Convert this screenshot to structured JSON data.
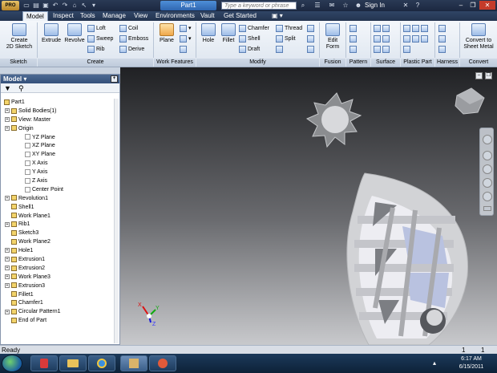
{
  "title_bar": {
    "app_button": "PRO",
    "document_title": "Part1",
    "search_placeholder": "Type a keyword or phrase",
    "sign_in": "Sign In",
    "icons": [
      "new-icon",
      "open-icon",
      "save-icon",
      "undo-icon",
      "redo-icon",
      "home-icon",
      "select-icon",
      "find-icon",
      "star-icon",
      "help-icon",
      "minimize-icon",
      "restore-icon",
      "close-icon"
    ]
  },
  "tabs": [
    "Model",
    "Inspect",
    "Tools",
    "Manage",
    "View",
    "Environments",
    "Vault",
    "Get Started"
  ],
  "active_tab": "Model",
  "ribbon": {
    "sketch": {
      "label": "Sketch",
      "create_2d": "Create\n2D Sketch"
    },
    "create": {
      "label": "Create",
      "extrude": "Extrude",
      "revolve": "Revolve",
      "loft": "Loft",
      "sweep": "Sweep",
      "rib": "Rib",
      "coil": "Coil",
      "emboss": "Emboss",
      "derive": "Derive"
    },
    "work_features": {
      "label": "Work Features",
      "plane": "Plane"
    },
    "modify": {
      "label": "Modify",
      "hole": "Hole",
      "fillet": "Fillet",
      "chamfer": "Chamfer",
      "shell": "Shell",
      "draft": "Draft",
      "thread": "Thread",
      "split": "Split"
    },
    "fusion": {
      "label": "Fusion",
      "edit_form": "Edit\nForm"
    },
    "pattern": {
      "label": "Pattern"
    },
    "surface": {
      "label": "Surface"
    },
    "plastic_part": {
      "label": "Plastic Part"
    },
    "harness": {
      "label": "Harness"
    },
    "convert": {
      "label": "Convert",
      "convert_sheet_metal": "Convert to\nSheet Metal"
    }
  },
  "browser": {
    "title": "Model",
    "items": [
      {
        "label": "Part1",
        "level": 0,
        "expander": false
      },
      {
        "label": "Solid Bodies(1)",
        "level": 1,
        "expander": true
      },
      {
        "label": "View: Master",
        "level": 1,
        "expander": true
      },
      {
        "label": "Origin",
        "level": 1,
        "expander": true
      },
      {
        "label": "YZ Plane",
        "level": 2,
        "expander": false
      },
      {
        "label": "XZ Plane",
        "level": 2,
        "expander": false
      },
      {
        "label": "XY Plane",
        "level": 2,
        "expander": false
      },
      {
        "label": "X Axis",
        "level": 2,
        "expander": false
      },
      {
        "label": "Y Axis",
        "level": 2,
        "expander": false
      },
      {
        "label": "Z Axis",
        "level": 2,
        "expander": false
      },
      {
        "label": "Center Point",
        "level": 2,
        "expander": false
      },
      {
        "label": "Revolution1",
        "level": 1,
        "expander": true
      },
      {
        "label": "Shell1",
        "level": 1,
        "expander": false
      },
      {
        "label": "Work Plane1",
        "level": 1,
        "expander": false
      },
      {
        "label": "Rib1",
        "level": 1,
        "expander": true
      },
      {
        "label": "Sketch3",
        "level": 1,
        "expander": false
      },
      {
        "label": "Work Plane2",
        "level": 1,
        "expander": false
      },
      {
        "label": "Hole1",
        "level": 1,
        "expander": true
      },
      {
        "label": "Extrusion1",
        "level": 1,
        "expander": true
      },
      {
        "label": "Extrusion2",
        "level": 1,
        "expander": true
      },
      {
        "label": "Work Plane3",
        "level": 1,
        "expander": true
      },
      {
        "label": "Extrusion3",
        "level": 1,
        "expander": true
      },
      {
        "label": "Fillet1",
        "level": 1,
        "expander": false
      },
      {
        "label": "Chamfer1",
        "level": 1,
        "expander": false
      },
      {
        "label": "Circular Pattern1",
        "level": 1,
        "expander": true
      },
      {
        "label": "End of Part",
        "level": 1,
        "expander": false
      }
    ]
  },
  "status": {
    "text": "Ready",
    "count1": "1",
    "count2": "1"
  },
  "clock": {
    "time": "6:17 AM",
    "date": "6/15/2011"
  },
  "axes": {
    "x": "X",
    "y": "Y",
    "z": "Z"
  }
}
